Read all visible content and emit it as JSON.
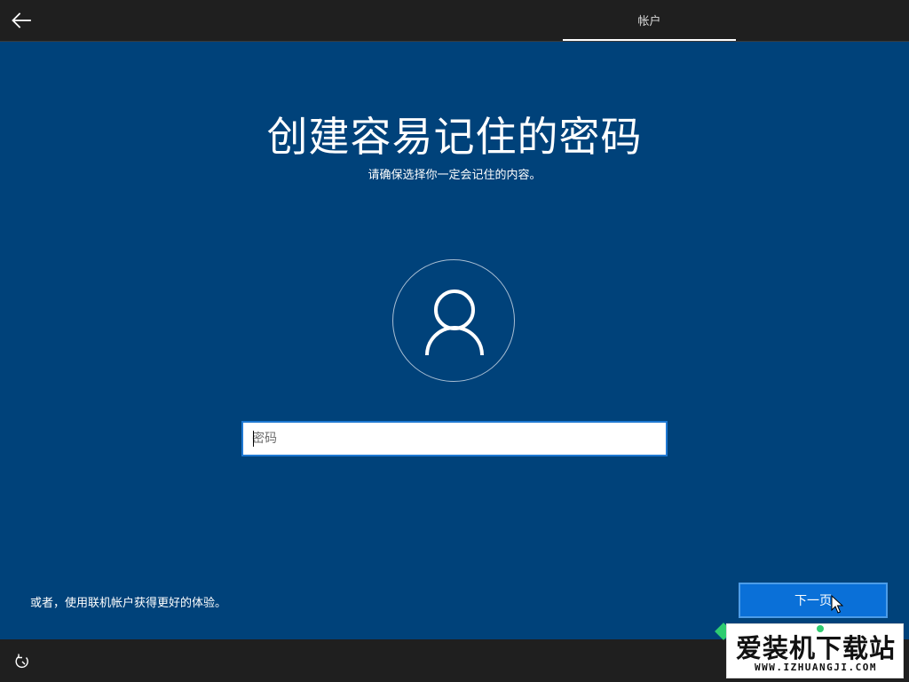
{
  "header": {
    "tab_label": "帐户",
    "back_icon": "back-arrow-icon"
  },
  "main": {
    "title": "创建容易记住的密码",
    "subtitle": "请确保选择你一定会记住的内容。",
    "avatar_icon": "user-icon",
    "password_field": {
      "placeholder": "密码",
      "value": ""
    }
  },
  "footer": {
    "online_account_link": "或者，使用联机帐户获得更好的体验。",
    "next_button": "下一页",
    "accessibility_icon": "accessibility-icon"
  },
  "watermark": {
    "name": "爱装机下载站",
    "url": "WWW.IZHUANGJI.COM"
  },
  "colors": {
    "background": "#00427a",
    "bar": "#1f1f1f",
    "accent": "#0a70d8"
  }
}
